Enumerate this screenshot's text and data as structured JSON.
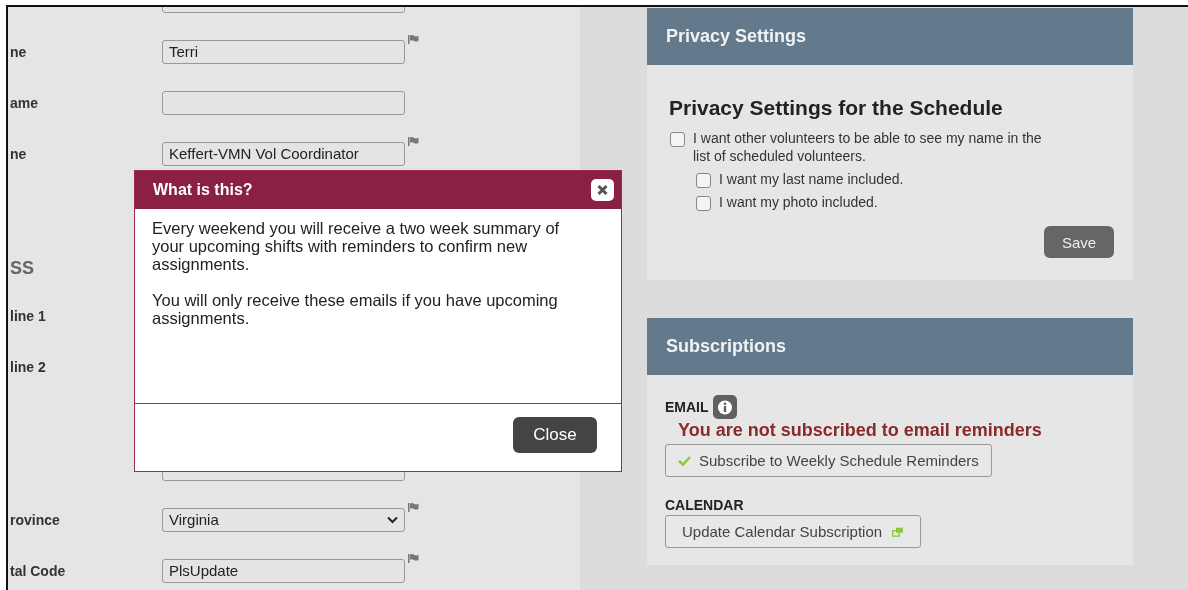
{
  "form": {
    "rows": [
      {
        "kind": "text",
        "label": "",
        "value": "",
        "flag": false
      },
      {
        "kind": "text",
        "label": "ne",
        "value": "Terri",
        "flag": true
      },
      {
        "kind": "text",
        "label": "ame",
        "value": "",
        "flag": false
      },
      {
        "kind": "text",
        "label": "ne",
        "value": "Keffert-VMN Vol Coordinator",
        "flag": true
      },
      {
        "kind": "heading",
        "label": "SS"
      },
      {
        "kind": "label",
        "label": "line 1"
      },
      {
        "kind": "label",
        "label": "line 2"
      },
      {
        "kind": "text",
        "label": "",
        "value": "",
        "flag": false
      },
      {
        "kind": "select",
        "label": "rovince",
        "value": "Virginia",
        "flag": true
      },
      {
        "kind": "text",
        "label": "tal Code",
        "value": "PlsUpdate",
        "flag": true
      }
    ]
  },
  "modal": {
    "title": "What is this?",
    "paragraphs": [
      "Every weekend you will receive a two week summary of your upcoming shifts with reminders to confirm new assignments.",
      "You will only receive these emails if you have upcoming assignments."
    ],
    "close_button": "Close"
  },
  "privacy": {
    "header": "Privacy Settings",
    "title": "Privacy Settings for the Schedule",
    "options": [
      {
        "label": "I want other volunteers to be able to see my name in the list of scheduled volunteers.",
        "checked": false,
        "children": [
          {
            "label": "I want my last name included.",
            "checked": false
          },
          {
            "label": "I want my photo included.",
            "checked": false
          }
        ]
      }
    ],
    "save_button": "Save"
  },
  "subscriptions": {
    "header": "Subscriptions",
    "email_label": "EMAIL",
    "status": "You are not subscribed to email reminders",
    "subscribe_button": "Subscribe to Weekly Schedule Reminders",
    "calendar_label": "CALENDAR",
    "calendar_button": "Update Calendar Subscription"
  }
}
